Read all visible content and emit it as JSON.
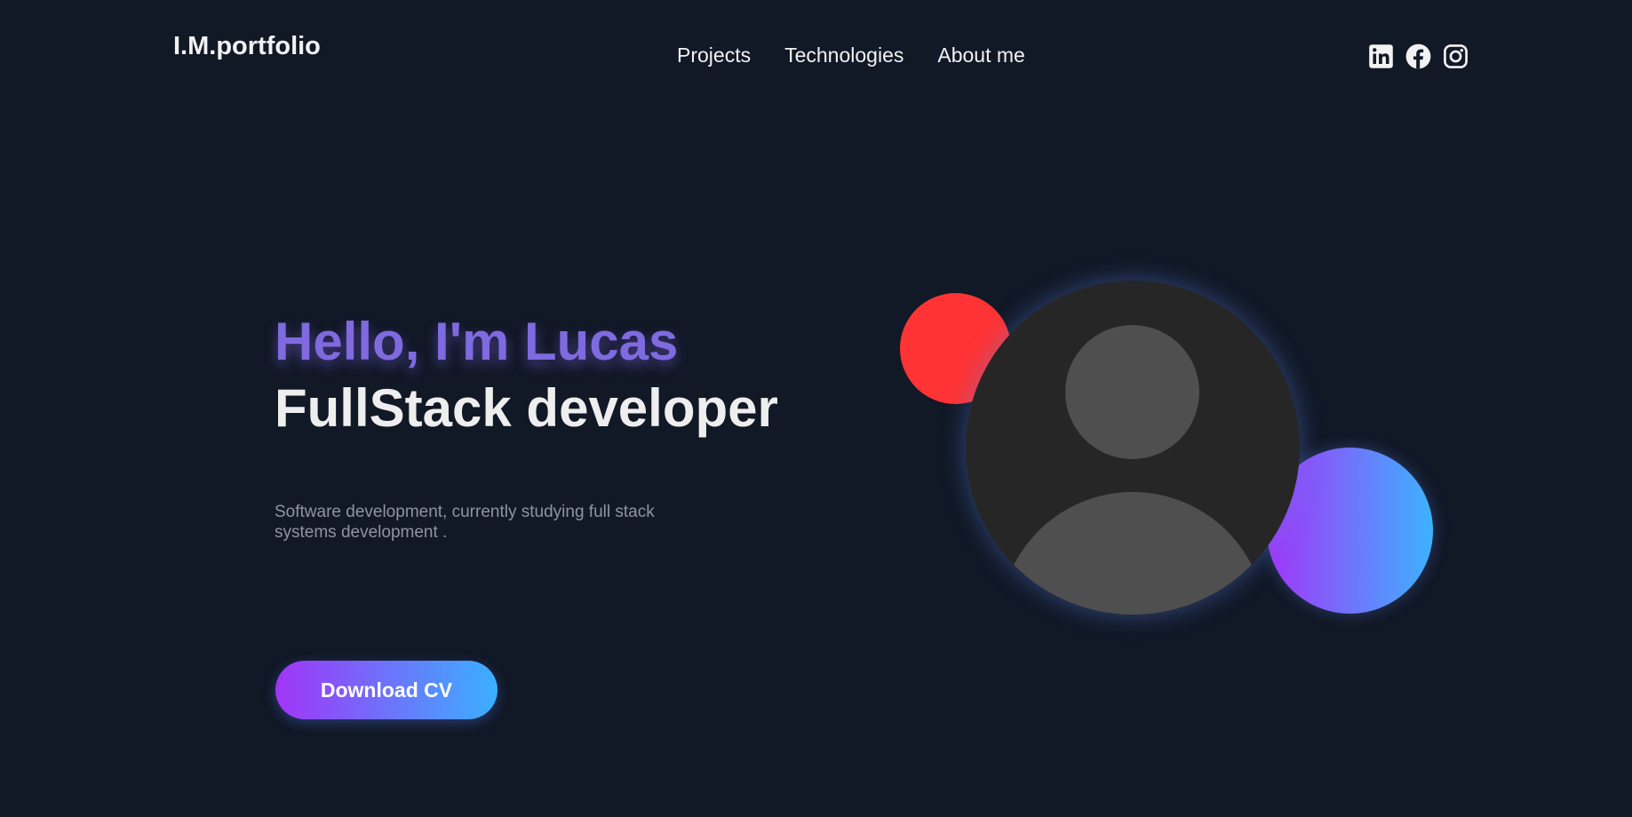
{
  "header": {
    "logo": "I.M.portfolio",
    "nav": [
      {
        "label": "Projects"
      },
      {
        "label": "Technologies"
      },
      {
        "label": "About me"
      }
    ],
    "socials": [
      {
        "icon": "linkedin-icon"
      },
      {
        "icon": "facebook-icon"
      },
      {
        "icon": "instagram-icon"
      }
    ]
  },
  "hero": {
    "greeting": "Hello, I'm Lucas",
    "role": "FullStack developer",
    "description": "Software development, currently studying full stack systems development .",
    "cta_label": "Download CV"
  },
  "colors": {
    "background": "#111826",
    "greeting": "#7f6ae0",
    "accent_red": "#ff3333",
    "gradient_start": "#a135f7",
    "gradient_end": "#3ab0ff"
  }
}
